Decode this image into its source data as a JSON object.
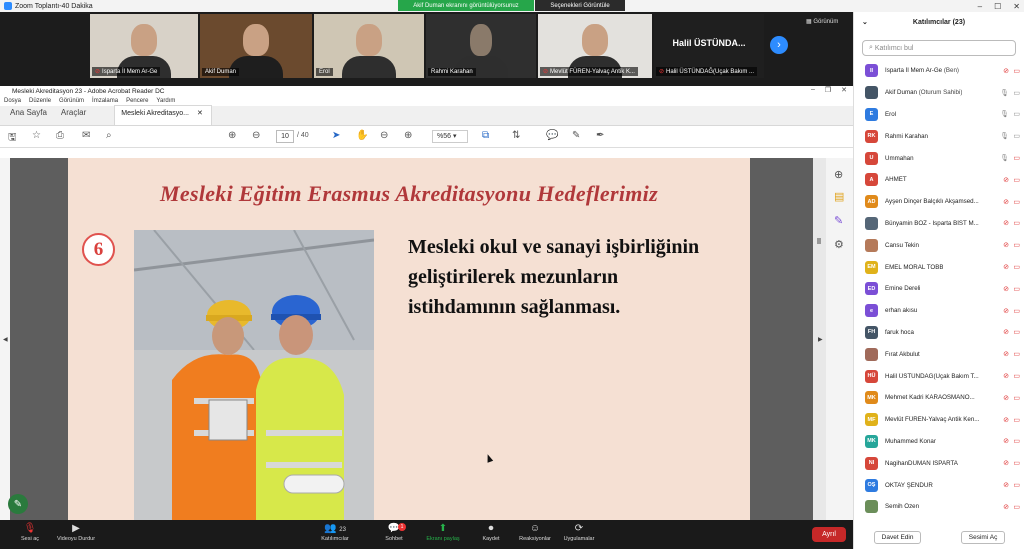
{
  "zoom": {
    "title": "Zoom Toplantı-40 Dakika",
    "share_banner": "Akif Duman ekranını görüntülüyorsunuz",
    "view_options": "Seçenekleri Görüntüle",
    "view_button": "Görünüm"
  },
  "video_tiles": [
    {
      "name": "Isparta İl Mem Ar-Ge",
      "muted": true
    },
    {
      "name": "Akif Duman",
      "muted": false
    },
    {
      "name": "Erol",
      "muted": false
    },
    {
      "name": "Rahmi Karahan",
      "muted": false
    },
    {
      "name": "Mevlüt FÜREN-Yalvaç Antik K...",
      "muted": true
    },
    {
      "name": "Halil ÜSTÜNDAĞ(Uçak Bakım ...",
      "muted": true,
      "big_name": "Halil ÜSTÜNDA..."
    }
  ],
  "acrobat": {
    "window_title": "Mesleki Akreditasyon 23 - Adobe Acrobat Reader DC",
    "menu": [
      "Dosya",
      "Düzenle",
      "Görünüm",
      "İmzalama",
      "Pencere",
      "Yardım"
    ],
    "tabs": {
      "home": "Ana Sayfa",
      "tools": "Araçlar",
      "document": "Mesleki Akreditasyo..."
    },
    "page_current": "10",
    "page_total": "/ 40",
    "zoom": "%56"
  },
  "slide": {
    "title": "Mesleki Eğitim Erasmus Akreditasyonu Hedeflerimiz",
    "number": "6",
    "text": "Mesleki okul ve sanayi işbirliğinin geliştirilerek mezunların istihdamının sağlanması."
  },
  "participants": {
    "header": "Katılımcılar (23)",
    "search_placeholder": "Katılımcı bul",
    "list": [
      {
        "initials": "II",
        "color": "#7b4fd6",
        "name": "Isparta İl Mem Ar-Ge",
        "role": "(Ben)",
        "mic": "off",
        "cam": "off"
      },
      {
        "initials": "",
        "color": "#445566",
        "name": "Akif Duman",
        "role": "(Oturum Sahibi)",
        "mic": "on",
        "cam": "on"
      },
      {
        "initials": "E",
        "color": "#2e7be0",
        "name": "Erol",
        "role": "",
        "mic": "on",
        "cam": "on"
      },
      {
        "initials": "RK",
        "color": "#d6473a",
        "name": "Rahmi Karahan",
        "role": "",
        "mic": "on",
        "cam": "on"
      },
      {
        "initials": "U",
        "color": "#d6473a",
        "name": "Ummahan",
        "role": "",
        "mic": "on",
        "cam": "off"
      },
      {
        "initials": "A",
        "color": "#d6473a",
        "name": "AHMET",
        "role": "",
        "mic": "off",
        "cam": "off"
      },
      {
        "initials": "AD",
        "color": "#e08a1a",
        "name": "Ayşen Dinçer Balçıklı Akşamsed...",
        "role": "",
        "mic": "off",
        "cam": "off"
      },
      {
        "initials": "",
        "color": "#556677",
        "name": "Bünyamin BOZ - Isparta BİST M...",
        "role": "",
        "mic": "off",
        "cam": "off"
      },
      {
        "initials": "",
        "color": "#b57a5a",
        "name": "Cansu Tekin",
        "role": "",
        "mic": "off",
        "cam": "off"
      },
      {
        "initials": "EM",
        "color": "#e0b21a",
        "name": "EMEL MORAL TOBB",
        "role": "",
        "mic": "off",
        "cam": "off"
      },
      {
        "initials": "ED",
        "color": "#7b4fd6",
        "name": "Emine Dereli",
        "role": "",
        "mic": "off",
        "cam": "off"
      },
      {
        "initials": "e",
        "color": "#7b4fd6",
        "name": "erhan akısu",
        "role": "",
        "mic": "off",
        "cam": "off"
      },
      {
        "initials": "FH",
        "color": "#445566",
        "name": "faruk hoca",
        "role": "",
        "mic": "off",
        "cam": "off"
      },
      {
        "initials": "",
        "color": "#a06a5a",
        "name": "Fırat Akbulut",
        "role": "",
        "mic": "off",
        "cam": "off"
      },
      {
        "initials": "HÜ",
        "color": "#d6473a",
        "name": "Halil ÜSTÜNDAĞ(Uçak Bakım T...",
        "role": "",
        "mic": "off",
        "cam": "off"
      },
      {
        "initials": "MK",
        "color": "#e08a1a",
        "name": "Mehmet Kadri KARAOSMANO...",
        "role": "",
        "mic": "off",
        "cam": "off"
      },
      {
        "initials": "MF",
        "color": "#e0b21a",
        "name": "Mevlüt FÜREN-Yalvaç Antik Ken...",
        "role": "",
        "mic": "off",
        "cam": "off"
      },
      {
        "initials": "MK",
        "color": "#26a69a",
        "name": "Muhammed Konar",
        "role": "",
        "mic": "off",
        "cam": "off"
      },
      {
        "initials": "NI",
        "color": "#d6473a",
        "name": "NagihanDUMAN ISPARTA",
        "role": "",
        "mic": "off",
        "cam": "off"
      },
      {
        "initials": "OŞ",
        "color": "#2e7be0",
        "name": "OKTAY ŞENDUR",
        "role": "",
        "mic": "off",
        "cam": "off"
      },
      {
        "initials": "",
        "color": "#6b8e5a",
        "name": "Semih Özen",
        "role": "",
        "mic": "off",
        "cam": "off"
      }
    ],
    "invite_button": "Davet Edin",
    "mute_all_button": "Sesimi Aç"
  },
  "bottom_bar": {
    "audio": "Sesi aç",
    "video": "Videoyu Durdur",
    "participants": "Katılımcılar",
    "participants_count": "23",
    "chat": "Sohbet",
    "chat_badge": "1",
    "share": "Ekranı paylaş",
    "record": "Kaydet",
    "reactions": "Reaksiyonlar",
    "apps": "Uygulamalar",
    "leave": "Ayrıl"
  }
}
